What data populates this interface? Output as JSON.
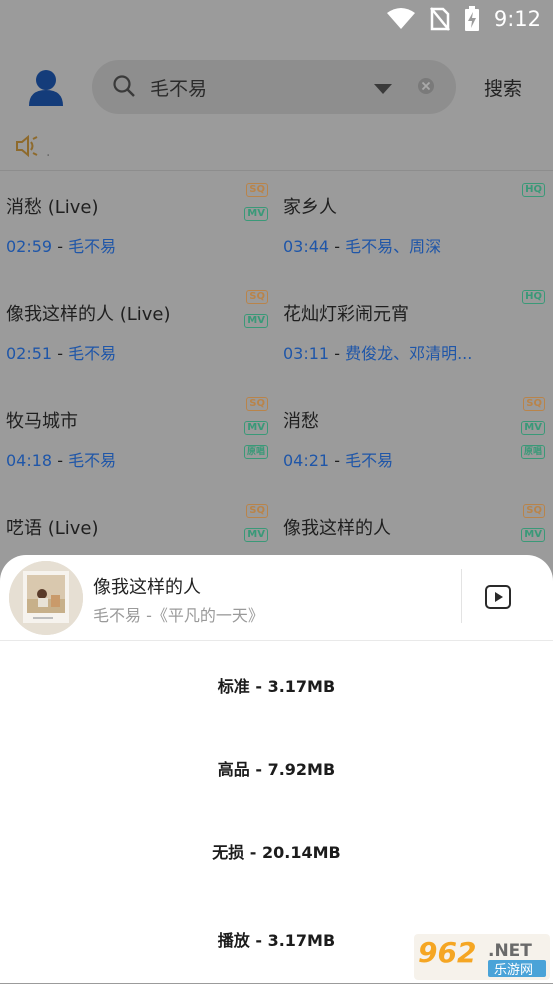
{
  "status_bar": {
    "time": "9:12"
  },
  "header": {
    "search_value": "毛不易",
    "search_button": "搜索"
  },
  "speaker_text": ".",
  "songs": [
    {
      "title": "消愁 (Live)",
      "duration": "02:59",
      "sep": " - ",
      "artist": "毛不易",
      "badges": [
        "SQ",
        "MV"
      ]
    },
    {
      "title": "家乡人",
      "duration": "03:44",
      "sep": " - ",
      "artist": "毛不易、周深",
      "badges": [
        "HQ"
      ]
    },
    {
      "title": "像我这样的人 (Live)",
      "duration": "02:51",
      "sep": " - ",
      "artist": "毛不易",
      "badges": [
        "SQ",
        "MV"
      ]
    },
    {
      "title": "花灿灯彩闹元宵",
      "duration": "03:11",
      "sep": " - ",
      "artist": "费俊龙、邓清明...",
      "badges": [
        "HQ"
      ]
    },
    {
      "title": "牧马城市",
      "duration": "04:18",
      "sep": " - ",
      "artist": "毛不易",
      "badges": [
        "SQ",
        "MV",
        "原唱"
      ]
    },
    {
      "title": "消愁",
      "duration": "04:21",
      "sep": " - ",
      "artist": "毛不易",
      "badges": [
        "SQ",
        "MV",
        "原唱"
      ]
    },
    {
      "title": "呓语 (Live)",
      "duration": "",
      "sep": "",
      "artist": "",
      "badges": [
        "SQ",
        "MV"
      ]
    },
    {
      "title": "像我这样的人",
      "duration": "",
      "sep": "",
      "artist": "",
      "badges": [
        "SQ",
        "MV"
      ]
    }
  ],
  "sheet": {
    "title": "像我这样的人",
    "subtitle": "毛不易 -《平凡的一天》",
    "options": [
      "标准 - 3.17MB",
      "高品 - 7.92MB",
      "无损 - 20.14MB",
      "播放 - 3.17MB"
    ]
  },
  "watermark": {
    "number": "962",
    "suffix": ".NET",
    "text": "乐游网"
  },
  "colors": {
    "overlay": "#9b9b9b",
    "link_blue": "#1f56a8",
    "badge_gold": "#b9844a",
    "badge_green": "#3a9978",
    "sheet_bg": "#ffffff"
  }
}
